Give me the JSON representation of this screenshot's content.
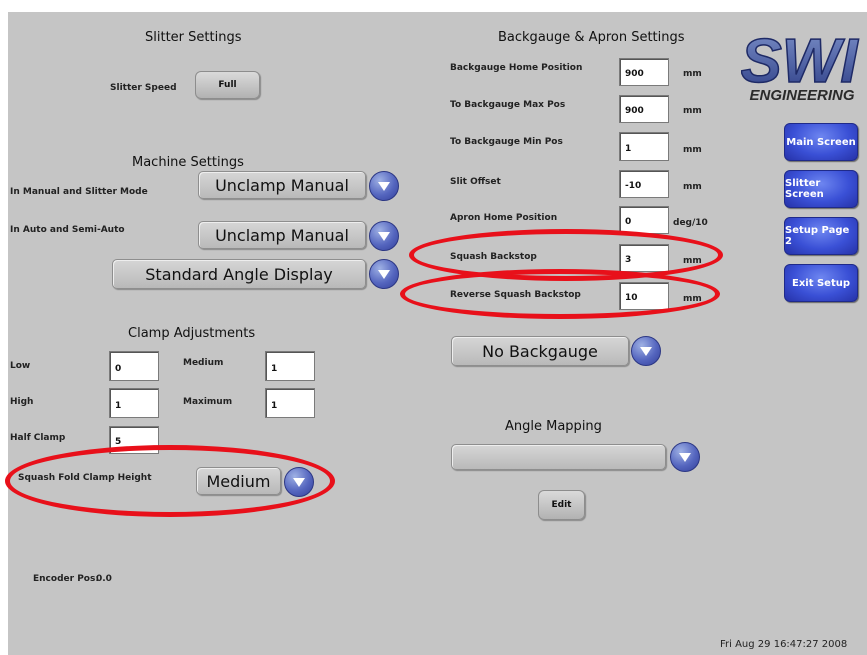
{
  "slitter": {
    "title": "Slitter Settings",
    "speed_label": "Slitter Speed",
    "speed_value": "Full"
  },
  "machine": {
    "title": "Machine Settings",
    "manual_label": "In Manual and Slitter Mode",
    "manual_value": "Unclamp Manual",
    "auto_label": "In Auto and Semi-Auto",
    "auto_value": "Unclamp Manual",
    "angle_display_value": "Standard Angle Display"
  },
  "clamp": {
    "title": "Clamp Adjustments",
    "low_label": "Low",
    "low_value": "0",
    "medium_label": "Medium",
    "medium_value": "1",
    "high_label": "High",
    "high_value": "1",
    "maximum_label": "Maximum",
    "maximum_value": "1",
    "half_label": "Half Clamp",
    "half_value": "5",
    "squash_label": "Squash Fold Clamp Height",
    "squash_value": "Medium"
  },
  "encoder": {
    "label": "Encoder Pos:",
    "value": "0.0"
  },
  "backgauge": {
    "title": "Backgauge & Apron Settings",
    "fields": [
      {
        "label": "Backgauge Home Position",
        "value": "900",
        "unit": "mm"
      },
      {
        "label": "To Backgauge Max Pos",
        "value": "900",
        "unit": "mm"
      },
      {
        "label": "To Backgauge Min Pos",
        "value": "1",
        "unit": "mm"
      },
      {
        "label": "Slit Offset",
        "value": "-10",
        "unit": "mm"
      },
      {
        "label": "Apron Home Position",
        "value": "0",
        "unit": "deg/10"
      },
      {
        "label": "Squash Backstop",
        "value": "3",
        "unit": "mm"
      },
      {
        "label": "Reverse Squash Backstop",
        "value": "10",
        "unit": "mm"
      }
    ],
    "mode_value": "No Backgauge"
  },
  "angle_mapping": {
    "title": "Angle Mapping",
    "value": "",
    "edit_label": "Edit"
  },
  "logo": {
    "mark": "SWI",
    "sub": "ENGINEERING"
  },
  "nav": {
    "main": "Main Screen",
    "slitter": "Slitter Screen",
    "setup2": "Setup Page 2",
    "exit": "Exit Setup"
  },
  "status": {
    "datetime": "Fri Aug 29 16:47:27 2008"
  },
  "colors": {
    "panel": "#c5c5c5",
    "accent_blue": "#3a50d6",
    "highlight_red": "#e8101a"
  }
}
